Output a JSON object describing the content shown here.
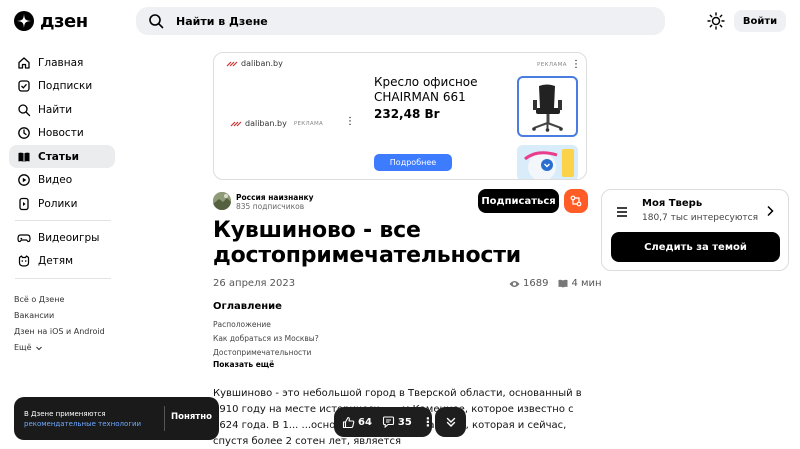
{
  "header": {
    "logo_text": "дзен",
    "search_placeholder": "Найти в Дзене",
    "login_label": "Войти"
  },
  "sidebar": {
    "items": [
      {
        "label": "Главная",
        "icon": "home-icon"
      },
      {
        "label": "Подписки",
        "icon": "subscriptions-icon"
      },
      {
        "label": "Найти",
        "icon": "search-icon"
      },
      {
        "label": "Новости",
        "icon": "news-icon"
      },
      {
        "label": "Статьи",
        "icon": "articles-icon",
        "active": true
      },
      {
        "label": "Видео",
        "icon": "video-icon"
      },
      {
        "label": "Ролики",
        "icon": "shorts-icon"
      }
    ],
    "items2": [
      {
        "label": "Видеоигры",
        "icon": "gamepad-icon"
      },
      {
        "label": "Детям",
        "icon": "kids-icon"
      }
    ],
    "footer_links": [
      "Всё о Дзене",
      "Вакансии",
      "Дзен на iOS и Android",
      "Ещё"
    ]
  },
  "ad": {
    "brand": "daliban.by",
    "label": "РЕКЛАМА",
    "product_title": "Кресло офисное CHAIRMAN 661",
    "price": "232,48 Br",
    "button": "Подробнее"
  },
  "article": {
    "author": "Россия наизнанку",
    "subscribers": "835 подписчиков",
    "subscribe_label": "Подписаться",
    "title": "Кувшиново - все достопримечательности",
    "date": "26 апреля 2023",
    "views": "1689",
    "read_time": "4 мин",
    "toc_title": "Оглавление",
    "toc": [
      "Расположение",
      "Как добраться из Москвы?",
      "Достопримечательности"
    ],
    "toc_more": "Показать ещё",
    "body": "Кувшиново - это небольшой город в Тверской области, основанный в 1910 году на месте историческ... ...м Каменное, которое известно с 1624 года. В 1... ...основана бумажная фабрика, которая и сейчас, спустя более 2 сотен лет, является"
  },
  "float_bar": {
    "likes": "64",
    "comments": "35"
  },
  "cookie": {
    "line1": "В Дзене применяются",
    "link": "рекомендательные технологии",
    "ok": "Понятно"
  },
  "topic_card": {
    "name": "Моя Тверь",
    "count": "180,7 тыс интересуются",
    "button": "Следить за темой"
  },
  "colors": {
    "accent": "#ff5c26",
    "ad_button": "#3d7bff",
    "link": "#6fa8ff"
  }
}
